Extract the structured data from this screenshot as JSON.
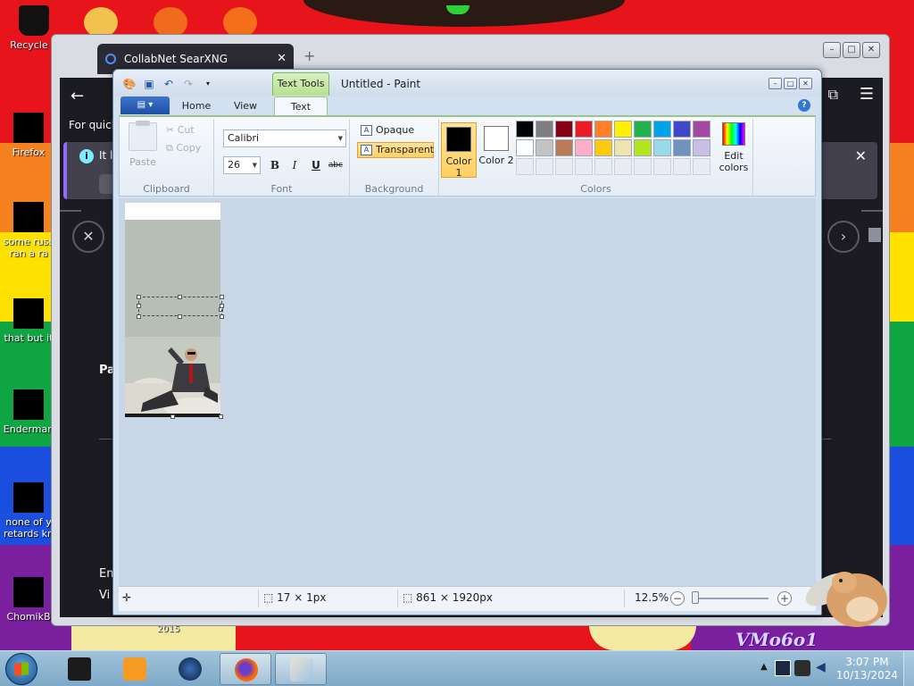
{
  "desktop": {
    "icons": [
      {
        "label": "Recycle B"
      },
      {
        "label": "Firefox"
      },
      {
        "label": "some russ ran a ra"
      },
      {
        "label": "that but it"
      },
      {
        "label": "Enderman"
      },
      {
        "label": "none of y retards kn"
      },
      {
        "label": "ChomikB"
      }
    ],
    "wallpaper_text_1": "2015",
    "wallpaper_text_2": "VMo6o1"
  },
  "browser": {
    "tab_title": "CollabNet SearXNG",
    "new_tab": "+",
    "quick_text": "For quick",
    "info_text": "It lo",
    "pa_label": "Pa",
    "em_label": "Em",
    "vi_label": "Vi"
  },
  "paint": {
    "title": "Untitled - Paint",
    "context_tab": "Text Tools",
    "file_menu": "▤ ▾",
    "tabs": [
      {
        "label": "Home"
      },
      {
        "label": "View"
      },
      {
        "label": "Text"
      }
    ],
    "clipboard": {
      "paste": "Paste",
      "cut": "Cut",
      "copy": "Copy",
      "label": "Clipboard"
    },
    "font": {
      "family": "Calibri",
      "size": "26",
      "bold": "B",
      "italic": "I",
      "underline": "U",
      "strikethrough": "abc",
      "label": "Font"
    },
    "background": {
      "opaque": "Opaque",
      "transparent": "Transparent",
      "label": "Background"
    },
    "colors": {
      "color1_label": "Color 1",
      "color2_label": "Color 2",
      "color1": "#000000",
      "color2": "#ffffff",
      "edit_label": "Edit colors",
      "label": "Colors",
      "palette_row1": [
        "#000000",
        "#7f7f7f",
        "#880015",
        "#ed1c24",
        "#ff7f27",
        "#fff200",
        "#22b14c",
        "#00a2e8",
        "#3f48cc",
        "#a349a4"
      ],
      "palette_row2": [
        "#ffffff",
        "#c3c3c3",
        "#b97a57",
        "#ffaec9",
        "#ffc90e",
        "#efe4b0",
        "#b5e61d",
        "#99d9ea",
        "#7092be",
        "#c8bfe7"
      ]
    },
    "status": {
      "selection_size": "17 × 1px",
      "image_size": "861 × 1920px",
      "zoom": "12.5%",
      "zoom_level": 0.02
    }
  },
  "taskbar": {
    "time": "3:07 PM",
    "date": "10/13/2024"
  }
}
